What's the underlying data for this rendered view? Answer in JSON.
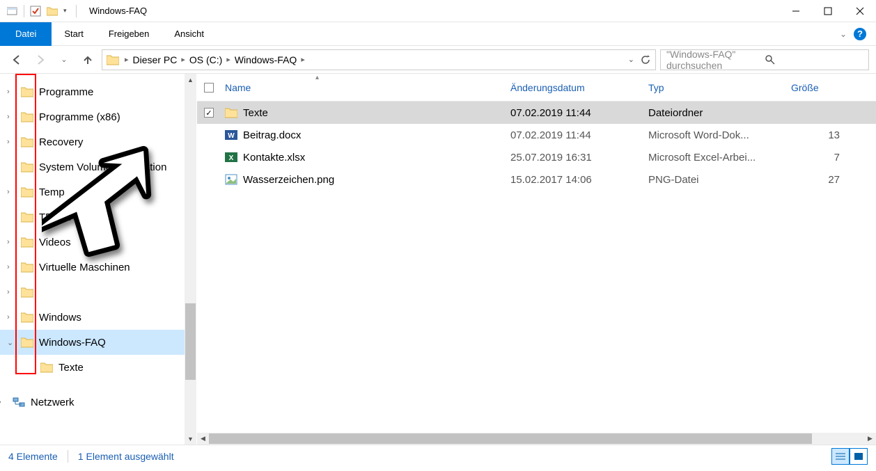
{
  "window": {
    "title": "Windows-FAQ"
  },
  "ribbon": {
    "file": "Datei",
    "tabs": [
      "Start",
      "Freigeben",
      "Ansicht"
    ]
  },
  "breadcrumbs": [
    "Dieser PC",
    "OS (C:)",
    "Windows-FAQ"
  ],
  "search": {
    "placeholder": "\"Windows-FAQ\" durchsuchen"
  },
  "columns": {
    "name": "Name",
    "date": "Änderungsdatum",
    "type": "Typ",
    "size": "Größe"
  },
  "tree": [
    {
      "label": "Programme",
      "expandable": true,
      "icon": "folder-shortcut"
    },
    {
      "label": "Programme (x86)",
      "expandable": true,
      "icon": "folder"
    },
    {
      "label": "Recovery",
      "expandable": true,
      "icon": "folder"
    },
    {
      "label": "System Volume Information",
      "expandable": false,
      "icon": "folder"
    },
    {
      "label": "Temp",
      "expandable": true,
      "icon": "folder"
    },
    {
      "label": "TFTP-Root",
      "expandable": false,
      "icon": "folder"
    },
    {
      "label": "Videos",
      "expandable": true,
      "icon": "folder"
    },
    {
      "label": "Virtuelle Maschinen",
      "expandable": true,
      "icon": "folder"
    },
    {
      "label": "",
      "expandable": true,
      "icon": "folder"
    },
    {
      "label": "Windows",
      "expandable": true,
      "icon": "folder"
    },
    {
      "label": "Windows-FAQ",
      "expandable": true,
      "expanded": true,
      "selected": true,
      "icon": "folder"
    },
    {
      "label": "Texte",
      "child": true,
      "icon": "folder"
    },
    {
      "label": "Netzwerk",
      "expandable": true,
      "icon": "network",
      "top_group": true
    }
  ],
  "files": [
    {
      "name": "Texte",
      "date": "07.02.2019 11:44",
      "type": "Dateiordner",
      "size": "",
      "icon": "folder",
      "selected": true,
      "checked": true
    },
    {
      "name": "Beitrag.docx",
      "date": "07.02.2019 11:44",
      "type": "Microsoft Word-Dok...",
      "size": "13",
      "icon": "word"
    },
    {
      "name": "Kontakte.xlsx",
      "date": "25.07.2019 16:31",
      "type": "Microsoft Excel-Arbei...",
      "size": "7",
      "icon": "excel"
    },
    {
      "name": "Wasserzeichen.png",
      "date": "15.02.2017 14:06",
      "type": "PNG-Datei",
      "size": "27",
      "icon": "image"
    }
  ],
  "status": {
    "count": "4 Elemente",
    "selected": "1 Element ausgewählt"
  }
}
